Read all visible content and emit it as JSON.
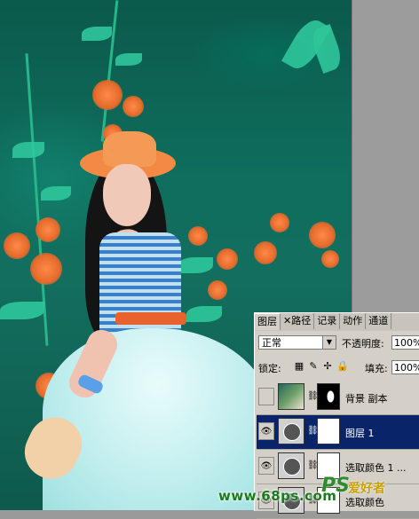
{
  "panel": {
    "tabs": [
      {
        "label": "图层"
      },
      {
        "label": "路径"
      },
      {
        "label": "记录"
      },
      {
        "label": "动作"
      },
      {
        "label": "通道"
      }
    ],
    "blend_mode": "正常",
    "opacity_label": "不透明度:",
    "opacity_value": "100%",
    "lock_label": "锁定:",
    "fill_label": "填充:",
    "fill_value": "100%",
    "layers": [
      {
        "name": "背景 副本",
        "selected": false,
        "visible": false
      },
      {
        "name": "图层 1",
        "selected": true,
        "visible": true
      },
      {
        "name": "选取颜色 1 ...",
        "selected": false,
        "visible": true
      },
      {
        "name": "选取颜色",
        "selected": false,
        "visible": true
      }
    ]
  },
  "watermark": {
    "url": "www.68ps.com",
    "logo": "PS",
    "logo_cn": "爱好者"
  }
}
